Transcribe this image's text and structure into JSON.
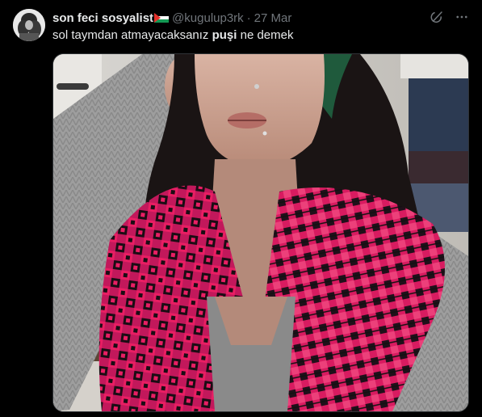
{
  "author": {
    "display_name": "son feci sosyalist",
    "handle": "@kugulup3rk",
    "separator": "·",
    "timestamp": "27 Mar",
    "flag_icon": "palestine-flag-icon",
    "avatar_icon": "profile-avatar"
  },
  "tweet": {
    "text_before": "sol taymdan atmayacaksanız ",
    "text_bold": "puşi",
    "text_after": " ne demek"
  },
  "actions": {
    "grok_icon": "grok-icon",
    "more_icon": "more-options-icon"
  },
  "media": {
    "alt_icon": "photo-selfie-pink-keffiyeh"
  },
  "colors": {
    "background": "#000000",
    "primary_text": "#e7e9ea",
    "secondary_text": "#71767b",
    "border": "#2f3336"
  }
}
